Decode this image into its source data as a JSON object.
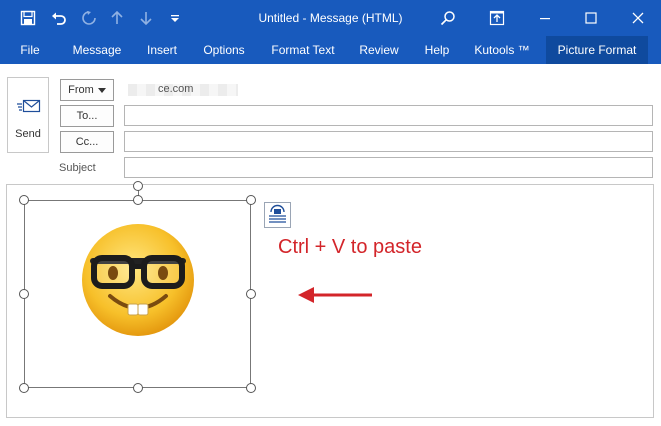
{
  "titlebar": {
    "title": "Untitled  -  Message (HTML)",
    "icons": [
      "save-icon",
      "undo-icon",
      "redo-icon",
      "up-arrow-icon",
      "down-arrow-icon",
      "customize-qat-icon",
      "search-icon",
      "ribbon-display-options-icon",
      "minimize-icon",
      "maximize-icon",
      "close-icon"
    ]
  },
  "ribbon": {
    "tabs": [
      {
        "label": "File"
      },
      {
        "label": "Message"
      },
      {
        "label": "Insert"
      },
      {
        "label": "Options"
      },
      {
        "label": "Format Text"
      },
      {
        "label": "Review"
      },
      {
        "label": "Help"
      },
      {
        "label": "Kutools ™"
      },
      {
        "label": "Picture Format",
        "active": true
      }
    ]
  },
  "compose": {
    "send_label": "Send",
    "from_label": "From",
    "from_address_suffix": "ce.com",
    "to_label": "To...",
    "cc_label": "Cc...",
    "subject_label": "Subject",
    "to_value": "",
    "cc_value": "",
    "subject_value": ""
  },
  "body": {
    "annotation": "Ctrl + V to paste",
    "image_icon": "nerd-face-emoji-icon",
    "layout_options_icon": "layout-options-icon"
  },
  "colors": {
    "titlebar": "#185abd",
    "active_tab": "#0f4a9e",
    "annotation": "#d3252a"
  }
}
